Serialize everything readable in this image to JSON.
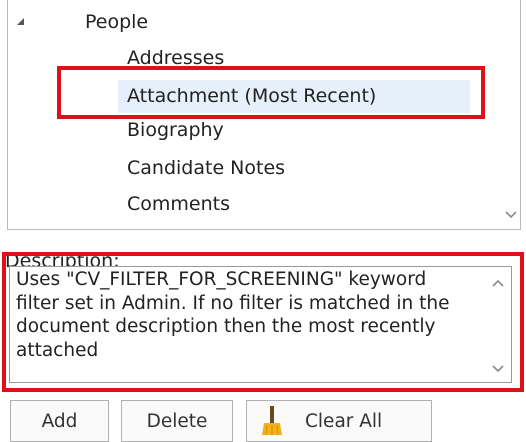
{
  "tree": {
    "root_label": "People",
    "items": [
      {
        "label": "Addresses"
      },
      {
        "label": "Attachment (Most Recent)",
        "selected": true
      },
      {
        "label": "Biography"
      },
      {
        "label": "Candidate Notes"
      },
      {
        "label": "Comments"
      }
    ]
  },
  "description": {
    "label": "Description:",
    "text": "Uses \"CV_FILTER_FOR_SCREENING\" keyword filter set in Admin. If no filter is matched in the document description then the most recently attached"
  },
  "buttons": {
    "add": "Add",
    "delete": "Delete",
    "clear_all": "Clear All"
  },
  "icons": {
    "broom": "broom-icon",
    "scroll_up": "scroll-up-icon",
    "scroll_down": "scroll-down-icon",
    "collapse": "collapse-triangle-icon"
  },
  "colors": {
    "highlight": "#e0101a",
    "selection": "#e6f0fa",
    "broom_yellow": "#f2b21c"
  }
}
